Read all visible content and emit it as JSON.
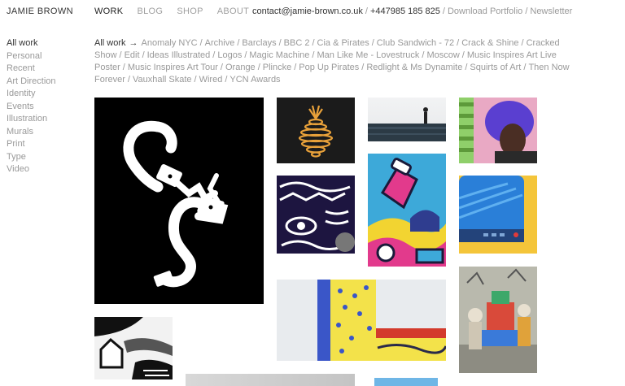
{
  "header": {
    "brand": "JAMIE BROWN",
    "nav": [
      {
        "label": "WORK",
        "active": true
      },
      {
        "label": "BLOG",
        "active": false
      },
      {
        "label": "SHOP",
        "active": false
      },
      {
        "label": "ABOUT",
        "active": false
      }
    ],
    "email": "contact@jamie-brown.co.uk",
    "phone": "+447985 185 825",
    "download": "Download Portfolio",
    "newsletter": "Newsletter"
  },
  "sidebar": {
    "items": [
      "All work",
      "Personal",
      "Recent",
      "Art Direction",
      "Identity",
      "Events",
      "Illustration",
      "Murals",
      "Print",
      "Type",
      "Video"
    ],
    "active_index": 0
  },
  "filters": {
    "active": "All work",
    "arrow_icon": "arrow-right-icon",
    "items": [
      "Anomaly NYC",
      "Archive",
      "Barclays",
      "BBC 2",
      "Cia & Pirates",
      "Club Sandwich - 72",
      "Crack & Shine",
      "Cracked Show",
      "Edit",
      "Ideas Illustrated",
      "Logos",
      "Magic Machine",
      "Man Like Me - Lovestruck",
      "Moscow",
      "Music Inspires Art Live Poster",
      "Music Inspires Art Tour",
      "Orange",
      "Plincke",
      "Pop Up Pirates",
      "Redlight & Ms Dynamite",
      "Squirts of Art",
      "Then Now Forever",
      "Vauxhall Skate",
      "Wired",
      "YCN Awards"
    ]
  },
  "colors": {
    "text": "#333333",
    "muted": "#999999",
    "nav_dim": "#a0a0a0"
  },
  "thumbnails": [
    {
      "name": "handcuffs-artwork"
    },
    {
      "name": "orange-spiral-artwork"
    },
    {
      "name": "rooftop-figure-photo"
    },
    {
      "name": "purple-hair-portrait"
    },
    {
      "name": "black-white-eye-pattern"
    },
    {
      "name": "colorful-illustration-bottle"
    },
    {
      "name": "blue-yellow-device-artwork"
    },
    {
      "name": "mural-wall-photo"
    },
    {
      "name": "sculpture-installation-photo"
    },
    {
      "name": "black-white-house-drawing"
    },
    {
      "name": "grey-tile-partial"
    },
    {
      "name": "blue-tile-partial"
    }
  ]
}
